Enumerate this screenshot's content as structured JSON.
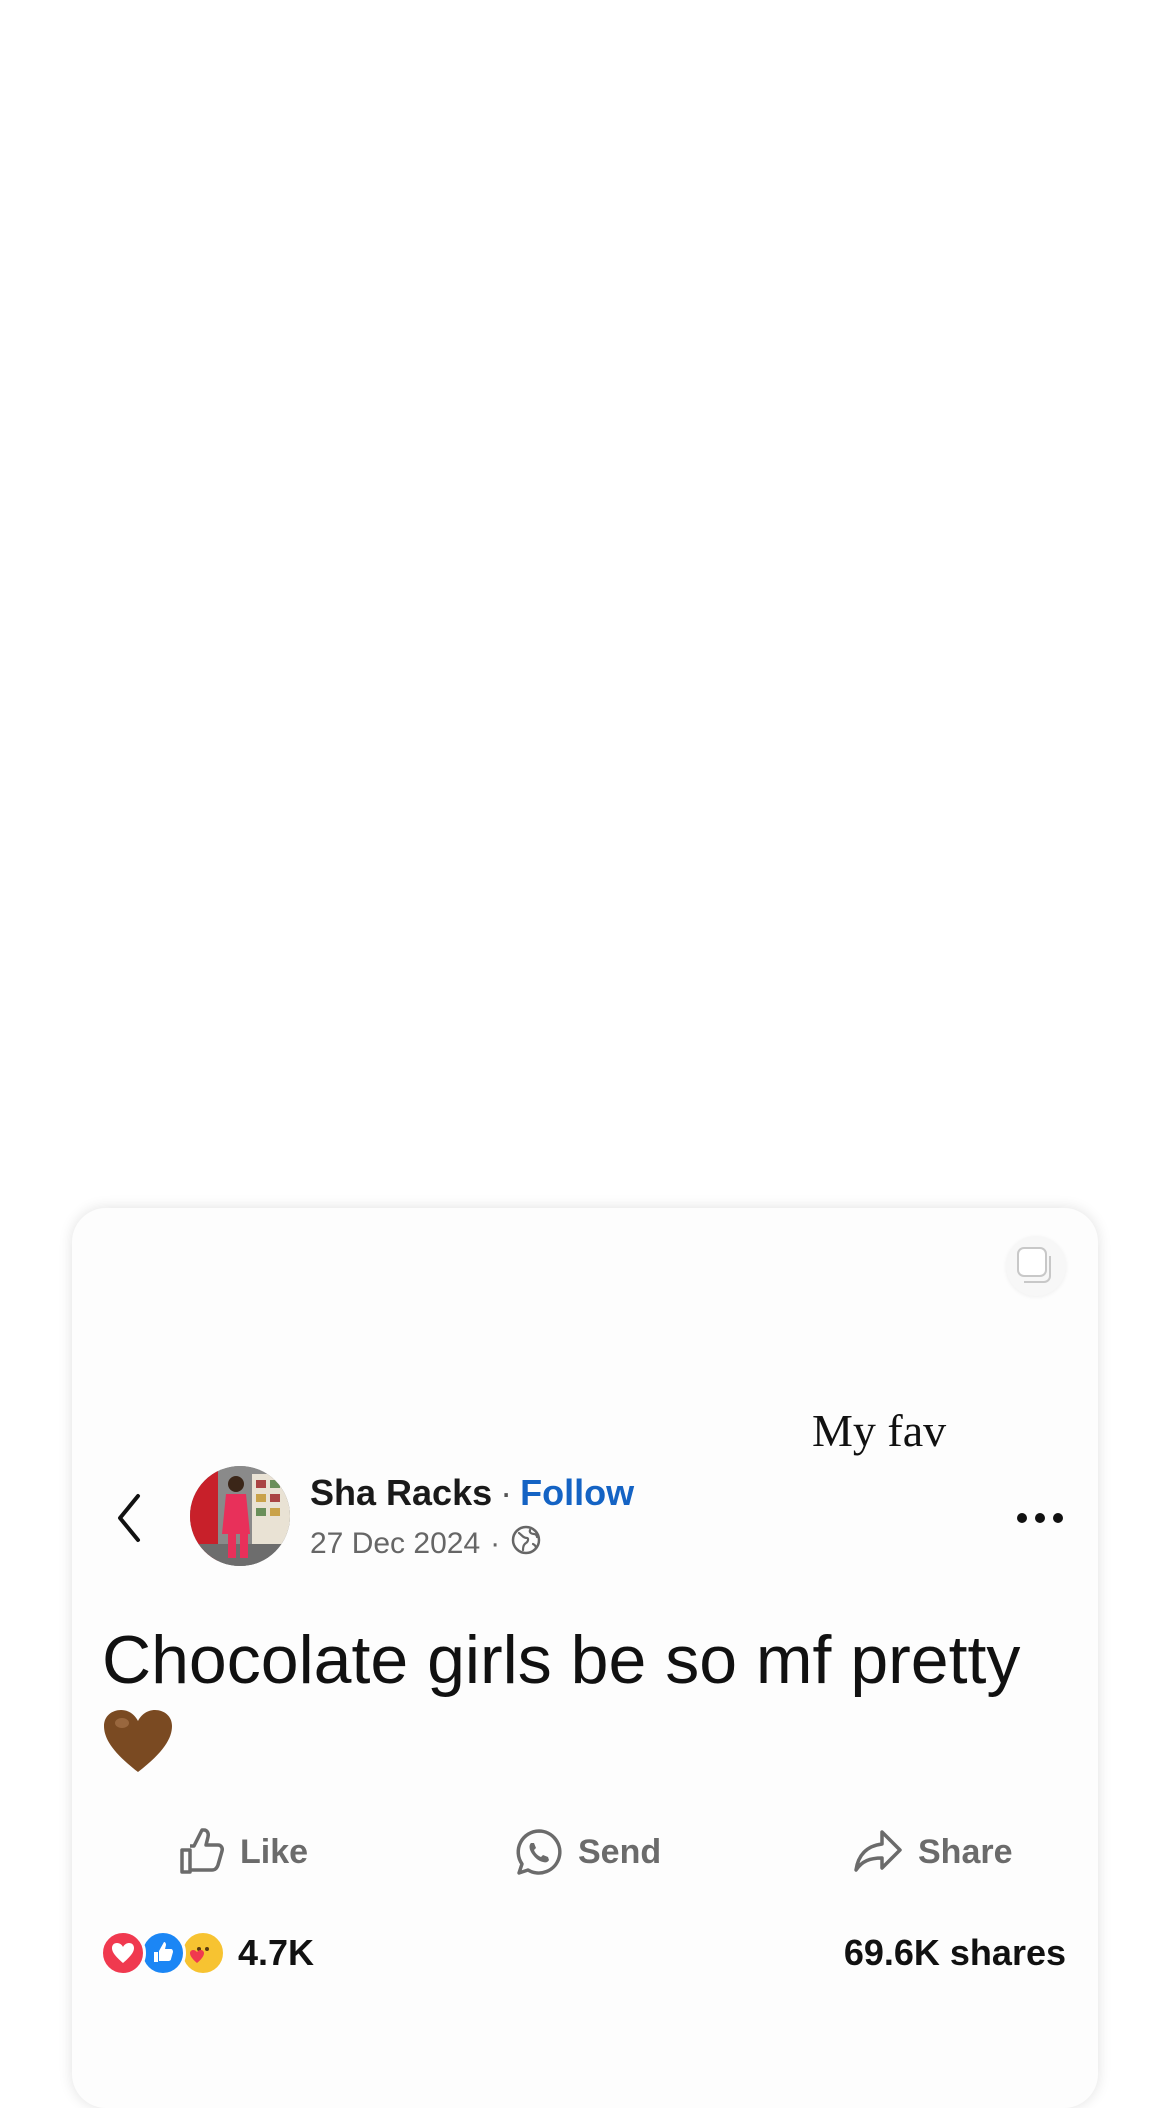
{
  "card": {
    "caption": "My fav",
    "author": {
      "name": "Sha Racks",
      "separator": "·",
      "follow_label": "Follow"
    },
    "meta": {
      "date": "27 Dec 2024",
      "separator": "·",
      "privacy_icon": "globe-icon"
    },
    "post": {
      "text": "Chocolate girls be so mf pretty"
    },
    "actions": [
      {
        "label": "Like",
        "icon": "thumbs-up-icon"
      },
      {
        "label": "Send",
        "icon": "whatsapp-icon"
      },
      {
        "label": "Share",
        "icon": "share-arrow-icon"
      }
    ],
    "stats": {
      "reactions": [
        "love",
        "like",
        "care"
      ],
      "reaction_count": "4.7K",
      "shares": "69.6K shares"
    },
    "colors": {
      "follow": "#1463c4",
      "love": "#f0394f",
      "like": "#1b86f5",
      "care": "#f7c331",
      "heart_emoji": "#7a4a22"
    }
  }
}
